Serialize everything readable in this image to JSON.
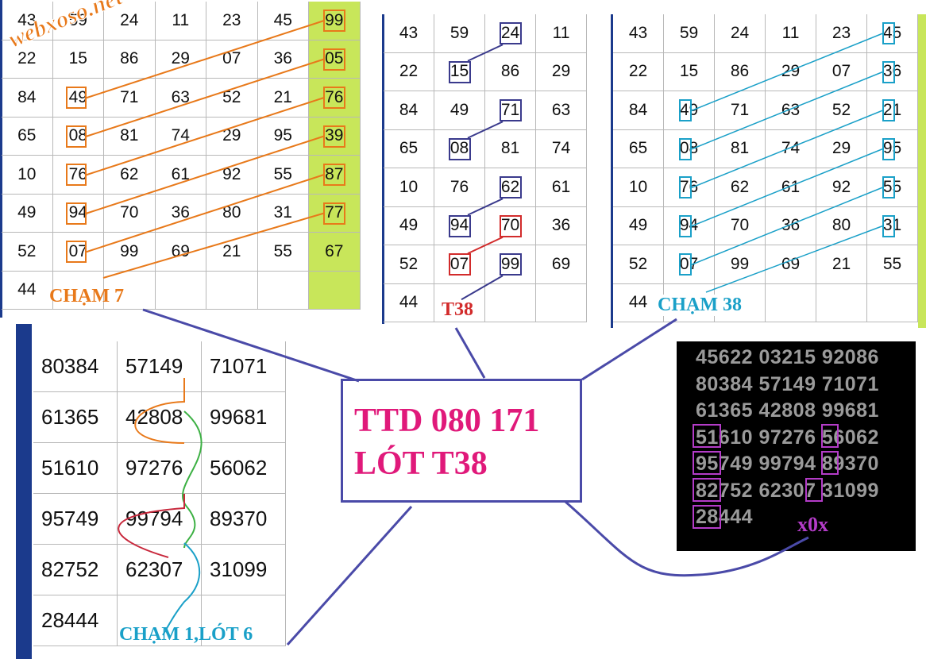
{
  "watermark": "webxoso.net",
  "colors": {
    "orange": "#e8791a",
    "navy": "#3a3a8c",
    "red": "#d22b2b",
    "cyan": "#1aa0c8",
    "magenta": "#e0197a",
    "purple": "#b43cc8",
    "green_column": "#c8e65a",
    "left_bar": "#1b3a8c",
    "connector": "#4a4aa8"
  },
  "panel1": {
    "label": "CHẠM 7",
    "rows": [
      [
        "43",
        "59",
        "24",
        "11",
        "23",
        "45",
        "99"
      ],
      [
        "22",
        "15",
        "86",
        "29",
        "07",
        "36",
        "05"
      ],
      [
        "84",
        "49",
        "71",
        "63",
        "52",
        "21",
        "76"
      ],
      [
        "65",
        "08",
        "81",
        "74",
        "29",
        "95",
        "39"
      ],
      [
        "10",
        "76",
        "62",
        "61",
        "92",
        "55",
        "87"
      ],
      [
        "49",
        "94",
        "70",
        "36",
        "80",
        "31",
        "77"
      ],
      [
        "52",
        "07",
        "99",
        "69",
        "21",
        "55",
        "67"
      ],
      [
        "44",
        "",
        "",
        "",
        "",
        "",
        ""
      ]
    ]
  },
  "panel2": {
    "label": "T38",
    "rows": [
      [
        "43",
        "59",
        "24",
        "11"
      ],
      [
        "22",
        "15",
        "86",
        "29"
      ],
      [
        "84",
        "49",
        "71",
        "63"
      ],
      [
        "65",
        "08",
        "81",
        "74"
      ],
      [
        "10",
        "76",
        "62",
        "61"
      ],
      [
        "49",
        "94",
        "70",
        "36"
      ],
      [
        "52",
        "07",
        "99",
        "69"
      ],
      [
        "44",
        "",
        "",
        ""
      ]
    ]
  },
  "panel3": {
    "label": "CHẠM 38",
    "rows": [
      [
        "43",
        "59",
        "24",
        "11",
        "23",
        "45"
      ],
      [
        "22",
        "15",
        "86",
        "29",
        "07",
        "36"
      ],
      [
        "84",
        "49",
        "71",
        "63",
        "52",
        "21"
      ],
      [
        "65",
        "08",
        "81",
        "74",
        "29",
        "95"
      ],
      [
        "10",
        "76",
        "62",
        "61",
        "92",
        "55"
      ],
      [
        "49",
        "94",
        "70",
        "36",
        "80",
        "31"
      ],
      [
        "52",
        "07",
        "99",
        "69",
        "21",
        "55"
      ],
      [
        "44",
        "",
        "",
        "",
        "",
        ""
      ]
    ]
  },
  "panel4": {
    "label": "CHẠM 1,LÓT 6",
    "rows": [
      [
        "80384",
        "57149",
        "71071"
      ],
      [
        "61365",
        "42808",
        "99681"
      ],
      [
        "51610",
        "97276",
        "56062"
      ],
      [
        "95749",
        "99794",
        "89370"
      ],
      [
        "82752",
        "62307",
        "31099"
      ],
      [
        "28444",
        "",
        ""
      ]
    ]
  },
  "center": {
    "line1": "TTD 080 171",
    "line2": "LÓT T38"
  },
  "black_panel": {
    "rows": [
      "45622 03215 92086",
      "80384 57149 71071",
      "61365 42808 99681",
      "51610 97276 56062",
      "95749 99794 89370",
      "82752 62307 31099",
      "28444"
    ],
    "label": "x0x"
  }
}
